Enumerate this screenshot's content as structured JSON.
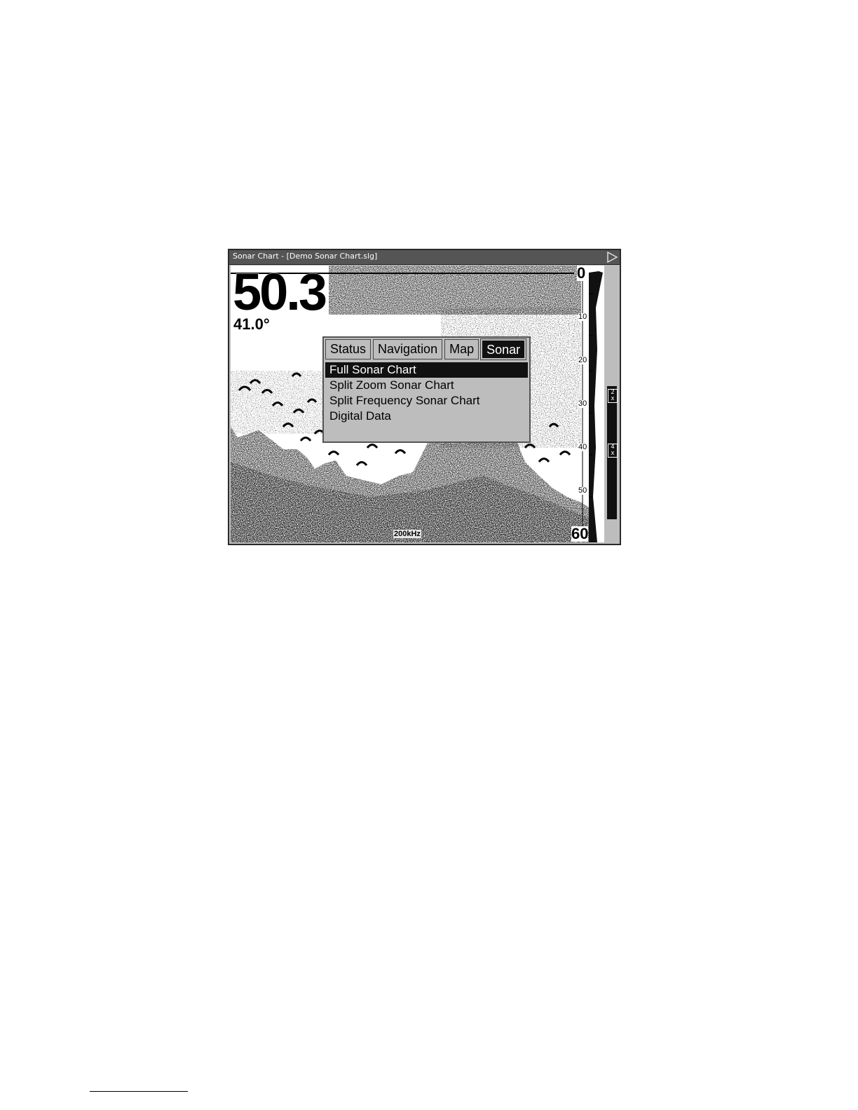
{
  "window": {
    "title": "Sonar Chart - [Demo Sonar Chart.slg]"
  },
  "readouts": {
    "depth": "50.3",
    "temperature": "41.0°",
    "frequency": "200kHz"
  },
  "depth_scale": {
    "top": "0",
    "ticks": [
      "10",
      "20",
      "30",
      "40",
      "50"
    ],
    "bottom": "60"
  },
  "zoom": {
    "levels": [
      "2\nx",
      "4\nx"
    ]
  },
  "menu": {
    "tabs": [
      {
        "label": "Status",
        "active": false
      },
      {
        "label": "Navigation",
        "active": false
      },
      {
        "label": "Map",
        "active": false
      },
      {
        "label": "Sonar",
        "active": true
      }
    ],
    "items": [
      {
        "label": "Full Sonar Chart",
        "selected": true
      },
      {
        "label": "Split Zoom Sonar Chart",
        "selected": false
      },
      {
        "label": "Split Frequency Sonar Chart",
        "selected": false
      },
      {
        "label": "Digital Data",
        "selected": false
      }
    ]
  },
  "icons": {
    "title_arrow": "play-arrow-icon"
  }
}
